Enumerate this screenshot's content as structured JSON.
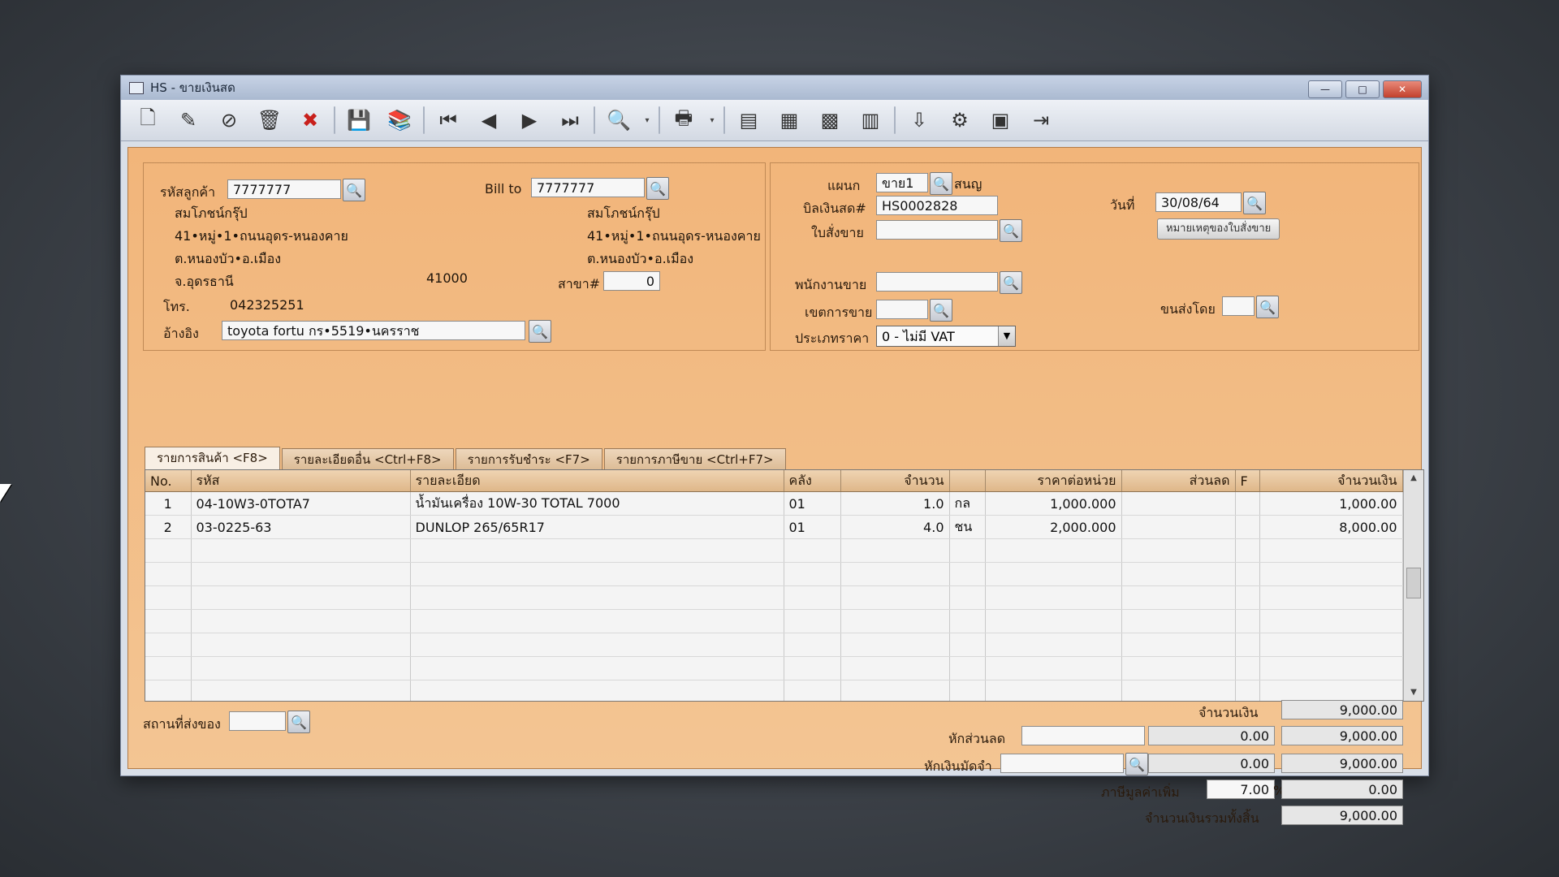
{
  "window": {
    "title": "HS - ขายเงินสด",
    "minimize": "—",
    "maximize": "□",
    "close": "✕"
  },
  "toolbar": [
    {
      "name": "new-document-icon",
      "glyph": "🗋"
    },
    {
      "name": "edit-icon",
      "glyph": "✎"
    },
    {
      "name": "void-icon",
      "glyph": "⊘"
    },
    {
      "name": "delete-icon",
      "glyph": "🗑"
    },
    {
      "name": "cancel-icon",
      "glyph": "✖",
      "red": true
    },
    {
      "name": "save-icon",
      "glyph": "💾"
    },
    {
      "name": "edit-book-icon",
      "glyph": "📚"
    },
    {
      "name": "first-record-icon",
      "glyph": "⏮"
    },
    {
      "name": "previous-record-icon",
      "glyph": "◀"
    },
    {
      "name": "next-record-icon",
      "glyph": "▶"
    },
    {
      "name": "last-record-icon",
      "glyph": "⏭"
    },
    {
      "name": "search-icon",
      "glyph": "🔍"
    },
    {
      "name": "search-dropdown-icon",
      "glyph": "▾",
      "small": true
    },
    {
      "name": "print-icon",
      "glyph": "🖶"
    },
    {
      "name": "print-dropdown-icon",
      "glyph": "▾",
      "small": true
    },
    {
      "name": "document-icon",
      "glyph": "▤"
    },
    {
      "name": "form-icon",
      "glyph": "▦"
    },
    {
      "name": "report-icon",
      "glyph": "▩"
    },
    {
      "name": "table-icon",
      "glyph": "▥"
    },
    {
      "name": "approve-icon",
      "glyph": "⇩"
    },
    {
      "name": "link-icon",
      "glyph": "⚙"
    },
    {
      "name": "ok-icon",
      "glyph": "▣"
    },
    {
      "name": "exit-icon",
      "glyph": "⇥"
    }
  ],
  "customer": {
    "code_label": "รหัสลูกค้า",
    "code": "7777777",
    "name": "สมโภชน์กรุ๊ป",
    "addr1": "41•หมู่•1•ถนนอุดร-หนองคาย",
    "addr2": "ต.หนองบัว•อ.เมือง",
    "addr3": "จ.อุดรธานี",
    "zip": "41000",
    "phone_label": "โทร.",
    "phone": "042325251",
    "ref_label": "อ้างอิง",
    "ref": "toyota fortu กร•5519•นครราช"
  },
  "billto": {
    "label": "Bill to",
    "code": "7777777",
    "name": "สมโภชน์กรุ๊ป",
    "addr1": "41•หมู่•1•ถนนอุดร-หนองคาย",
    "addr2": "ต.หนองบัว•อ.เมือง",
    "branch_label": "สาขา#",
    "branch": "0"
  },
  "doc": {
    "dept_label": "แผนก",
    "dept": "ขาย1",
    "dept_name": "สนญ",
    "bill_label": "บิลเงินสด#",
    "bill_no": "HS0002828",
    "so_label": "ใบสั่งขาย",
    "so": "",
    "date_label": "วันที่",
    "date": "30/08/64",
    "so_note_button": "หมายเหตุของใบสั่งขาย",
    "salesman_label": "พนักงานขาย",
    "salesman": "",
    "zone_label": "เขตการขาย",
    "zone": "",
    "shipby_label": "ขนส่งโดย",
    "shipby": "",
    "pricetype_label": "ประเภทราคา",
    "pricetype": "0 - ไม่มี VAT"
  },
  "tabs": [
    "รายการสินค้า <F8>",
    "รายละเอียดอื่น <Ctrl+F8>",
    "รายการรับชำระ <F7>",
    "รายการภาษีขาย <Ctrl+F7>"
  ],
  "grid": {
    "headers": [
      "No.",
      "รหัส",
      "รายละเอียด",
      "คลัง",
      "จำนวน",
      "",
      "ราคาต่อหน่วย",
      "ส่วนลด",
      "F",
      "จำนวนเงิน"
    ],
    "rows": [
      [
        "1",
        "04-10W3-0TOTA7",
        "น้ำมันเครื่อง 10W-30 TOTAL 7000",
        "01",
        "1.0",
        "กล",
        "1,000.000",
        "",
        "",
        "1,000.00"
      ],
      [
        "2",
        "03-0225-63",
        "DUNLOP 265/65R17",
        "01",
        "4.0",
        "ชน",
        "2,000.000",
        "",
        "",
        "8,000.00"
      ]
    ]
  },
  "footer": {
    "ship_place_label": "สถานที่ส่งของ",
    "ship_place": "",
    "amount_label": "จำนวนเงิน",
    "amount": "9,000.00",
    "discount_label": "หักส่วนลด",
    "discount_input": "",
    "discount_value": "0.00",
    "after_discount": "9,000.00",
    "deposit_label": "หักเงินมัดจำ",
    "deposit_input": "",
    "deposit_value": "0.00",
    "after_deposit": "9,000.00",
    "vat_label": "ภาษีมูลค่าเพิ่ม",
    "vat_rate": "7.00",
    "vat_pct": "%",
    "vat_amount": "0.00",
    "total_label": "จำนวนเงินรวมทั้งสิ้น",
    "total": "9,000.00"
  }
}
